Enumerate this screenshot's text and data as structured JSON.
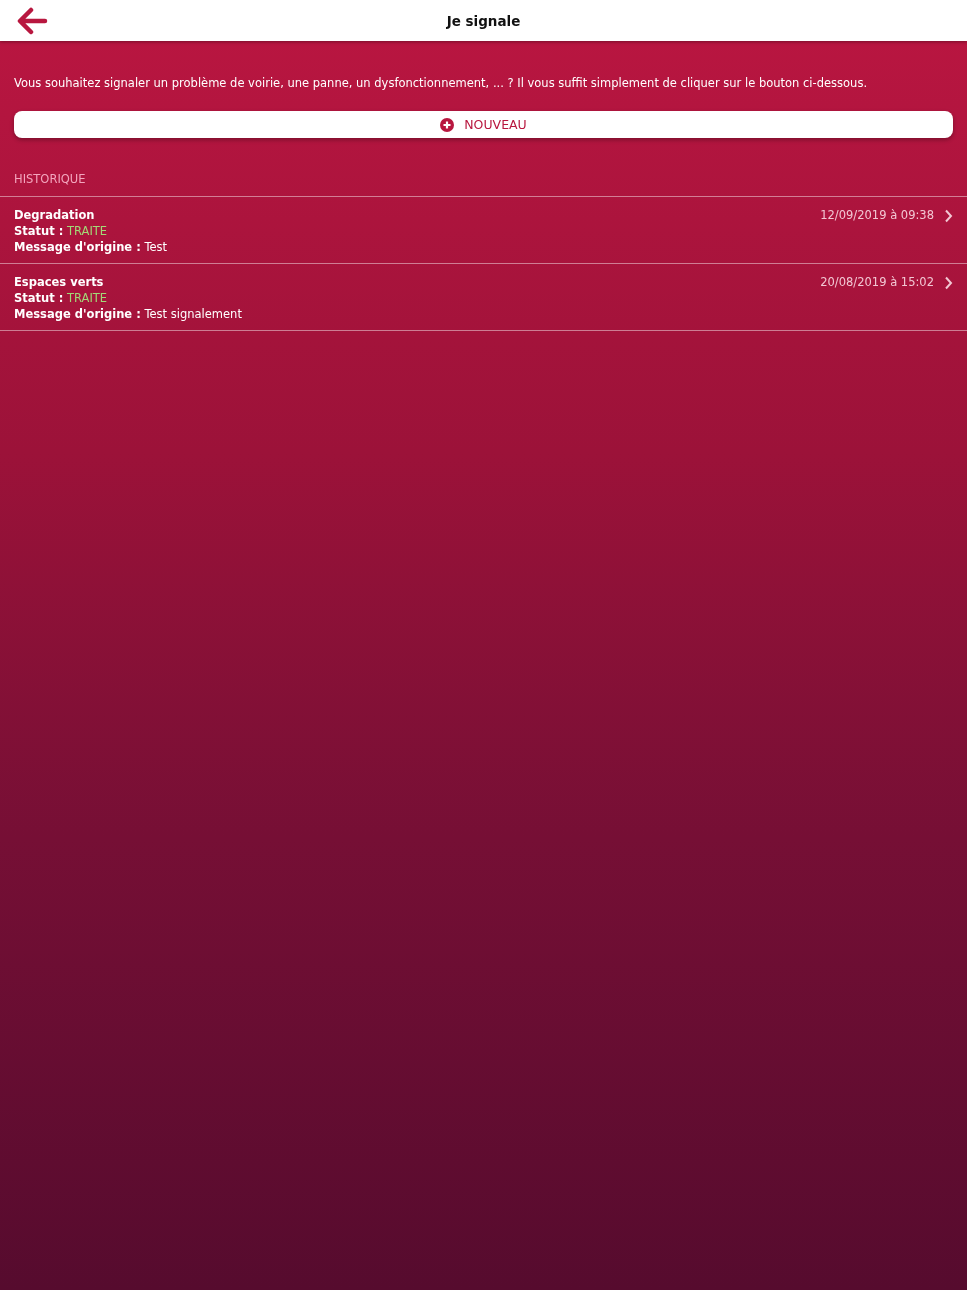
{
  "header": {
    "title": "Je signale"
  },
  "intro": "Vous souhaitez signaler un problème de voirie, une panne, un dysfonctionnement, ... ? Il vous suffit simplement de cliquer sur le bouton ci-dessous.",
  "new_button": {
    "label": "NOUVEAU"
  },
  "history": {
    "heading": "HISTORIQUE",
    "items": [
      {
        "title": "Degradation",
        "date": "12/09/2019 à 09:38",
        "status_label": "Statut :",
        "status": {
          "text": "TRAITE",
          "color": "#a3d977"
        },
        "message_label": "Message d'origine :",
        "message": "Test"
      },
      {
        "title": "Espaces verts",
        "date": "20/08/2019 à 15:02",
        "status_label": "Statut :",
        "status": {
          "text": "TRAITE",
          "color": "#a3d977"
        },
        "message_label": "Message d'origine :",
        "message": "Test signalement"
      }
    ]
  }
}
